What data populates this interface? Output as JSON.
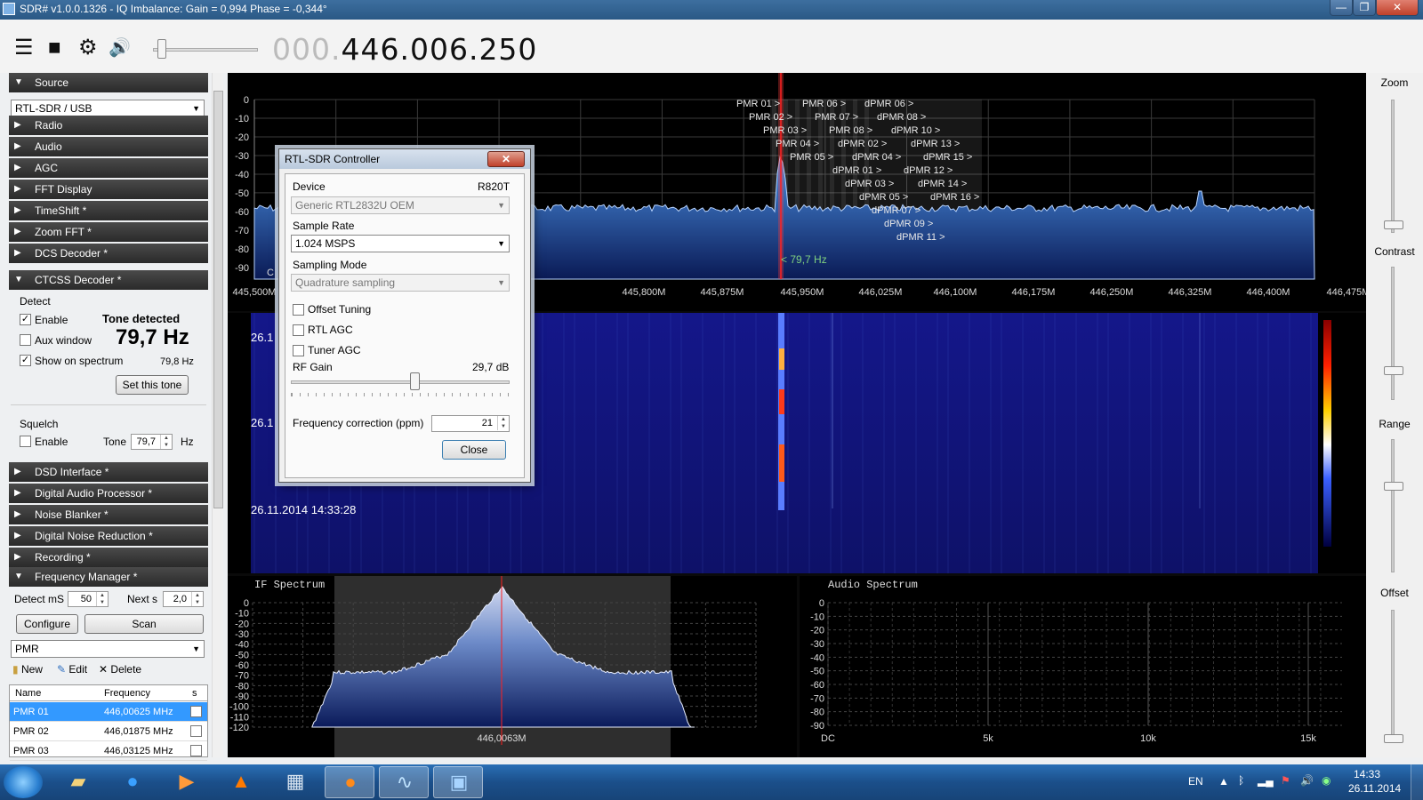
{
  "window": {
    "title": "SDR# v1.0.0.1326 - IQ Imbalance: Gain = 0,994 Phase = -0,344°",
    "minimize": "—",
    "restore": "❐",
    "close": "✕"
  },
  "toolbar": {
    "menu_icon": "☰",
    "stop_icon": "■",
    "settings_icon": "⚙",
    "volume_icon": "🔊",
    "volume_level": 0.05,
    "freq_dim": "000.",
    "freq_main": "446.006.250"
  },
  "sidebar": {
    "source": {
      "label": "Source",
      "combo": "RTL-SDR / USB"
    },
    "sections_a": [
      "Radio",
      "Audio",
      "AGC",
      "FFT Display",
      "TimeShift *",
      "Zoom FFT *",
      "DCS Decoder *"
    ],
    "ctcss": {
      "label": "CTCSS Decoder *",
      "detect": "Detect",
      "enable": "Enable",
      "tone_detected": "Tone detected",
      "aux_window": "Aux window",
      "tone_value": "79,7 Hz",
      "show_on_spectrum": "Show on spectrum",
      "small_value": "79,8 Hz",
      "set_tone": "Set this tone",
      "squelch": "Squelch",
      "sq_enable": "Enable",
      "tone_lbl": "Tone",
      "tone_input": "79,7",
      "hz": "Hz",
      "enable_checked": true,
      "aux_checked": false,
      "show_checked": true,
      "sq_checked": false
    },
    "sections_b": [
      "DSD Interface *",
      "Digital Audio Processor *",
      "Noise Blanker *",
      "Digital Noise Reduction *",
      "Recording *"
    ],
    "fm": {
      "label": "Frequency Manager *",
      "detect_ms": "Detect mS",
      "detect_val": "50",
      "next_s": "Next s",
      "next_val": "2,0",
      "configure": "Configure",
      "scan": "Scan",
      "group": "PMR",
      "new": "New",
      "edit": "Edit",
      "delete": "Delete",
      "col_name": "Name",
      "col_freq": "Frequency",
      "col_s": "s",
      "rows": [
        {
          "name": "PMR 01",
          "freq": "446,00625 MHz"
        },
        {
          "name": "PMR 02",
          "freq": "446,01875 MHz"
        },
        {
          "name": "PMR 03",
          "freq": "446,03125 MHz"
        }
      ]
    }
  },
  "spectrum": {
    "ylabels": [
      "0",
      "-10",
      "-20",
      "-30",
      "-40",
      "-50",
      "-60",
      "-70",
      "-80",
      "-90"
    ],
    "xlabels": [
      "445,500M",
      "445,800M",
      "445,875M",
      "445,950M",
      "446,025M",
      "446,100M",
      "446,175M",
      "446,250M",
      "446,325M",
      "446,400M",
      "446,475M"
    ],
    "tone_marker": "< 79,7 Hz",
    "channel_labels": [
      "PMR 01 >",
      "PMR 06 >",
      "dPMR 06 >",
      "PMR 02 >",
      "PMR 07 >",
      "dPMR 08 >",
      "PMR 03 >",
      "PMR 08 >",
      "dPMR 10 >",
      "PMR 04 >",
      "dPMR 02 >",
      "dPMR 13 >",
      "PMR 05 >",
      "dPMR 04 >",
      "dPMR 15 >",
      "dPMR 01 >",
      "dPMR 12 >",
      "dPMR 03 >",
      "dPMR 14 >",
      "dPMR 05 >",
      "dPMR 16 >",
      "dPMR 07 >",
      "dPMR 09 >",
      "dPMR 11 >"
    ],
    "left_stub": "C"
  },
  "waterfall": {
    "ts1": "26.1",
    "ts2": "26.1",
    "ts3": "26.11.2014 14:33:28"
  },
  "if_spectrum": {
    "title": "IF Spectrum",
    "ylabels": [
      "0",
      "-10",
      "-20",
      "-30",
      "-40",
      "-50",
      "-60",
      "-70",
      "-80",
      "-90",
      "-100",
      "-110",
      "-120"
    ],
    "xlabel": "446,0063M"
  },
  "audio_spectrum": {
    "title": "Audio Spectrum",
    "ylabels": [
      "0",
      "-10",
      "-20",
      "-30",
      "-40",
      "-50",
      "-60",
      "-70",
      "-80",
      "-90"
    ],
    "xlabels": [
      "DC",
      "5k",
      "10k",
      "15k"
    ]
  },
  "right_panel": {
    "zoom": "Zoom",
    "contrast": "Contrast",
    "range": "Range",
    "offset": "Offset"
  },
  "dialog": {
    "title": "RTL-SDR Controller",
    "close_x": "✕",
    "device_lbl": "Device",
    "device_tuner": "R820T",
    "device_combo": "Generic RTL2832U OEM",
    "sample_rate_lbl": "Sample Rate",
    "sample_rate": "1.024 MSPS",
    "sampling_mode_lbl": "Sampling Mode",
    "sampling_mode": "Quadrature sampling",
    "offset_tuning": "Offset Tuning",
    "rtl_agc": "RTL AGC",
    "tuner_agc": "Tuner AGC",
    "rf_gain_lbl": "RF Gain",
    "rf_gain": "29,7 dB",
    "rf_gain_fraction": 0.57,
    "freq_corr_lbl": "Frequency correction (ppm)",
    "freq_corr": "21",
    "close": "Close"
  },
  "taskbar": {
    "lang": "EN",
    "time": "14:33",
    "date": "26.11.2014"
  }
}
